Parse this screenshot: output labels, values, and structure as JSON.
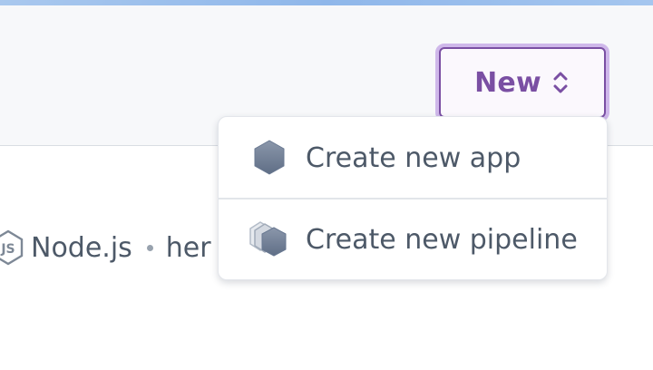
{
  "header": {
    "new_button_label": "New",
    "chevron_icon": "chevron-up-down-icon"
  },
  "app_context": {
    "runtime_icon": "nodejs-icon",
    "runtime_label": "Node.js",
    "separator": "•",
    "secondary_text": "her"
  },
  "dropdown": {
    "items": [
      {
        "label": "Create new app",
        "icon": "app-hexagon-icon"
      },
      {
        "label": "Create new pipeline",
        "icon": "pipeline-stack-icon"
      }
    ]
  },
  "colors": {
    "accent": "#7a4fa3",
    "text_muted": "#4d5968",
    "header_bg": "#f7f8fa"
  }
}
